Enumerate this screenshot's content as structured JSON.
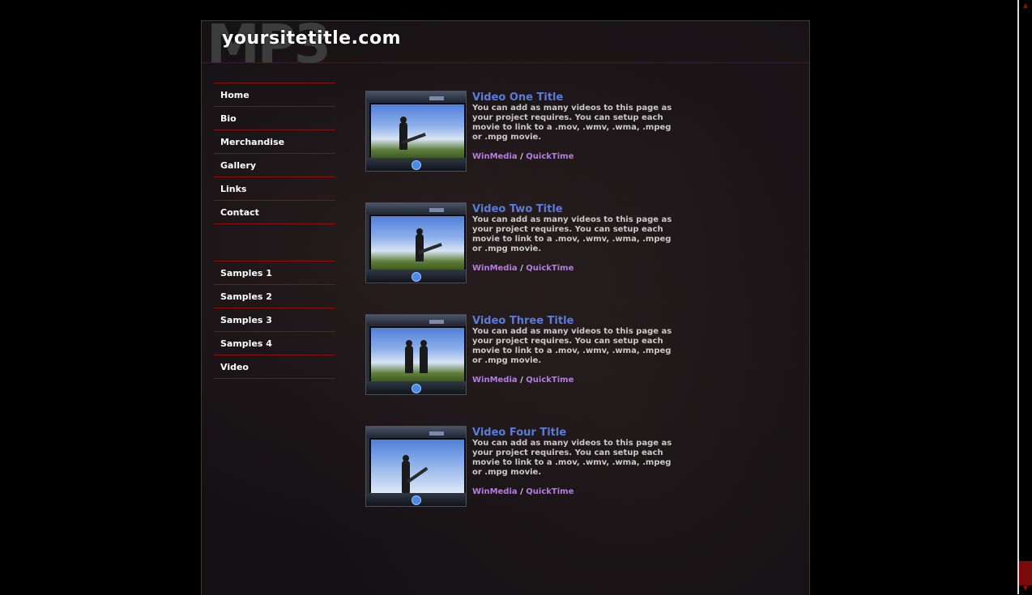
{
  "header": {
    "bg_text": "MP3",
    "site_title": "yoursitetitle.com"
  },
  "nav_main": [
    {
      "label": "Home"
    },
    {
      "label": "Bio"
    },
    {
      "label": "Merchandise"
    },
    {
      "label": "Gallery"
    },
    {
      "label": "Links"
    },
    {
      "label": "Contact"
    }
  ],
  "nav_secondary": [
    {
      "label": "Samples 1"
    },
    {
      "label": "Samples 2"
    },
    {
      "label": "Samples 3"
    },
    {
      "label": "Samples 4"
    },
    {
      "label": "Video"
    }
  ],
  "videos": [
    {
      "title": "Video One Title",
      "description": "You can add as many videos to this page as your project requires. You can setup each movie to link to a .mov, .wmv, .wma, .mpeg or .mpg movie.",
      "link1": "WinMedia",
      "separator": "/",
      "link2": "QuickTime"
    },
    {
      "title": "Video Two Title",
      "description": "You can add as many videos to this page as your project requires. You can setup each movie to link to a .mov, .wmv, .wma, .mpeg or .mpg movie.",
      "link1": "WinMedia",
      "separator": "/",
      "link2": "QuickTime"
    },
    {
      "title": "Video Three Title",
      "description": "You can add as many videos to this page as your project requires. You can setup each movie to link to a .mov, .wmv, .wma, .mpeg or .mpg movie.",
      "link1": "WinMedia",
      "separator": "/",
      "link2": "QuickTime"
    },
    {
      "title": "Video Four Title",
      "description": "You can add as many videos to this page as your project requires. You can setup each movie to link to a .mov, .wmv, .wma, .mpeg or .mpg movie.",
      "link1": "WinMedia",
      "separator": "/",
      "link2": "QuickTime"
    }
  ],
  "colors": {
    "accent_red": "#8a0f0f",
    "title_blue": "#5b7bd8",
    "link_purple": "#b57ce8"
  }
}
